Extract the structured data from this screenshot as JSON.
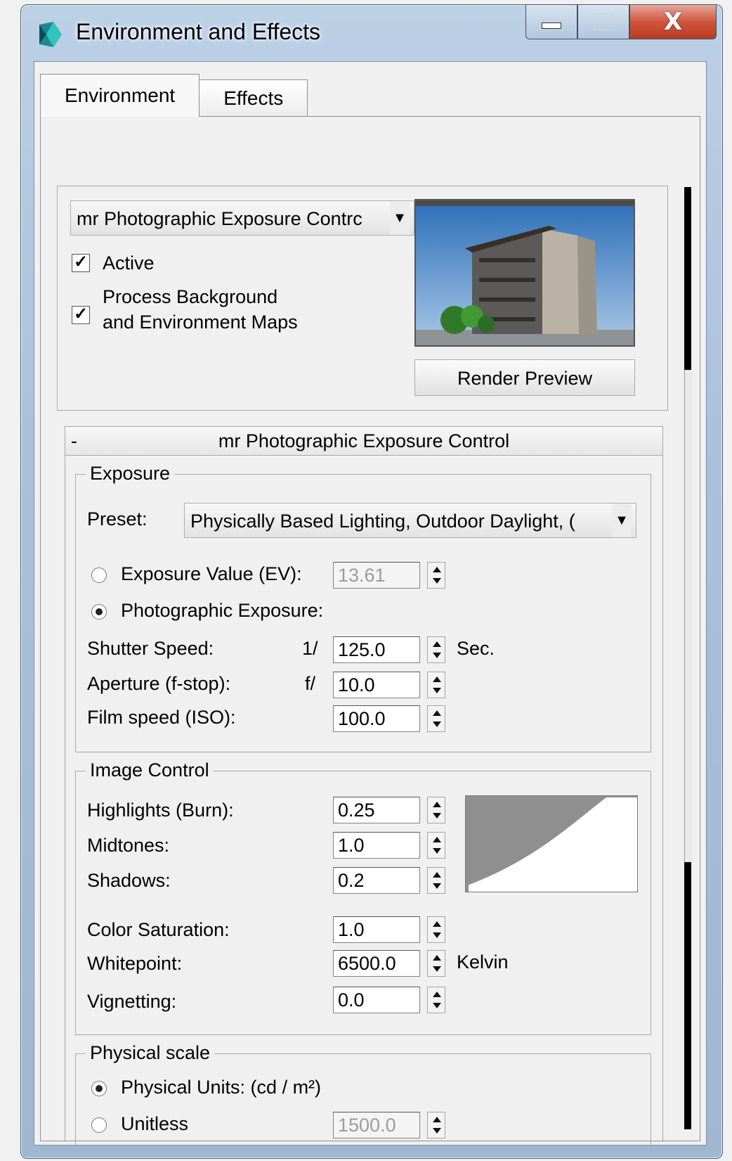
{
  "window": {
    "title": "Environment and Effects",
    "close_glyph": "X"
  },
  "tabs": [
    {
      "label": "Environment",
      "active": true
    },
    {
      "label": "Effects",
      "active": false
    }
  ],
  "exposure_section": {
    "type_dropdown_value": "mr Photographic Exposure Contrc",
    "active_label": "Active",
    "active_checked": true,
    "process_bg_label_line1": "Process Background",
    "process_bg_label_line2": "and Environment Maps",
    "process_bg_checked": true,
    "render_preview_label": "Render Preview"
  },
  "rollout": {
    "collapse_glyph": "-",
    "title": "mr Photographic Exposure Control"
  },
  "exposure_group": {
    "legend": "Exposure",
    "preset_label": "Preset:",
    "preset_value": "Physically Based Lighting, Outdoor Daylight, (",
    "ev_label": "Exposure Value (EV):",
    "ev_value": "13.61",
    "photographic_label": "Photographic Exposure:",
    "shutter_label": "Shutter Speed:",
    "shutter_prefix": "1/",
    "shutter_value": "125.0",
    "shutter_unit": "Sec.",
    "aperture_label": "Aperture (f-stop):",
    "aperture_prefix": "f/",
    "aperture_value": "10.0",
    "iso_label": "Film speed (ISO):",
    "iso_value": "100.0"
  },
  "image_control_group": {
    "legend": "Image Control",
    "highlights_label": "Highlights (Burn):",
    "highlights_value": "0.25",
    "midtones_label": "Midtones:",
    "midtones_value": "1.0",
    "shadows_label": "Shadows:",
    "shadows_value": "0.2",
    "saturation_label": "Color Saturation:",
    "saturation_value": "1.0",
    "whitepoint_label": "Whitepoint:",
    "whitepoint_value": "6500.0",
    "whitepoint_unit": "Kelvin",
    "vignetting_label": "Vignetting:",
    "vignetting_value": "0.0"
  },
  "physical_scale_group": {
    "legend": "Physical scale",
    "physical_units_label": "Physical Units: (cd / m²)",
    "unitless_label": "Unitless",
    "unitless_value": "1500.0"
  },
  "icons": {
    "app": "3dsmax-app-icon",
    "dropdown": "chevron-down-icon",
    "spinner": "spinner-arrows-icon"
  },
  "colors": {
    "titlebar": "#a9c1da",
    "close_button": "#c9452c",
    "panel": "#f0f0f0"
  }
}
